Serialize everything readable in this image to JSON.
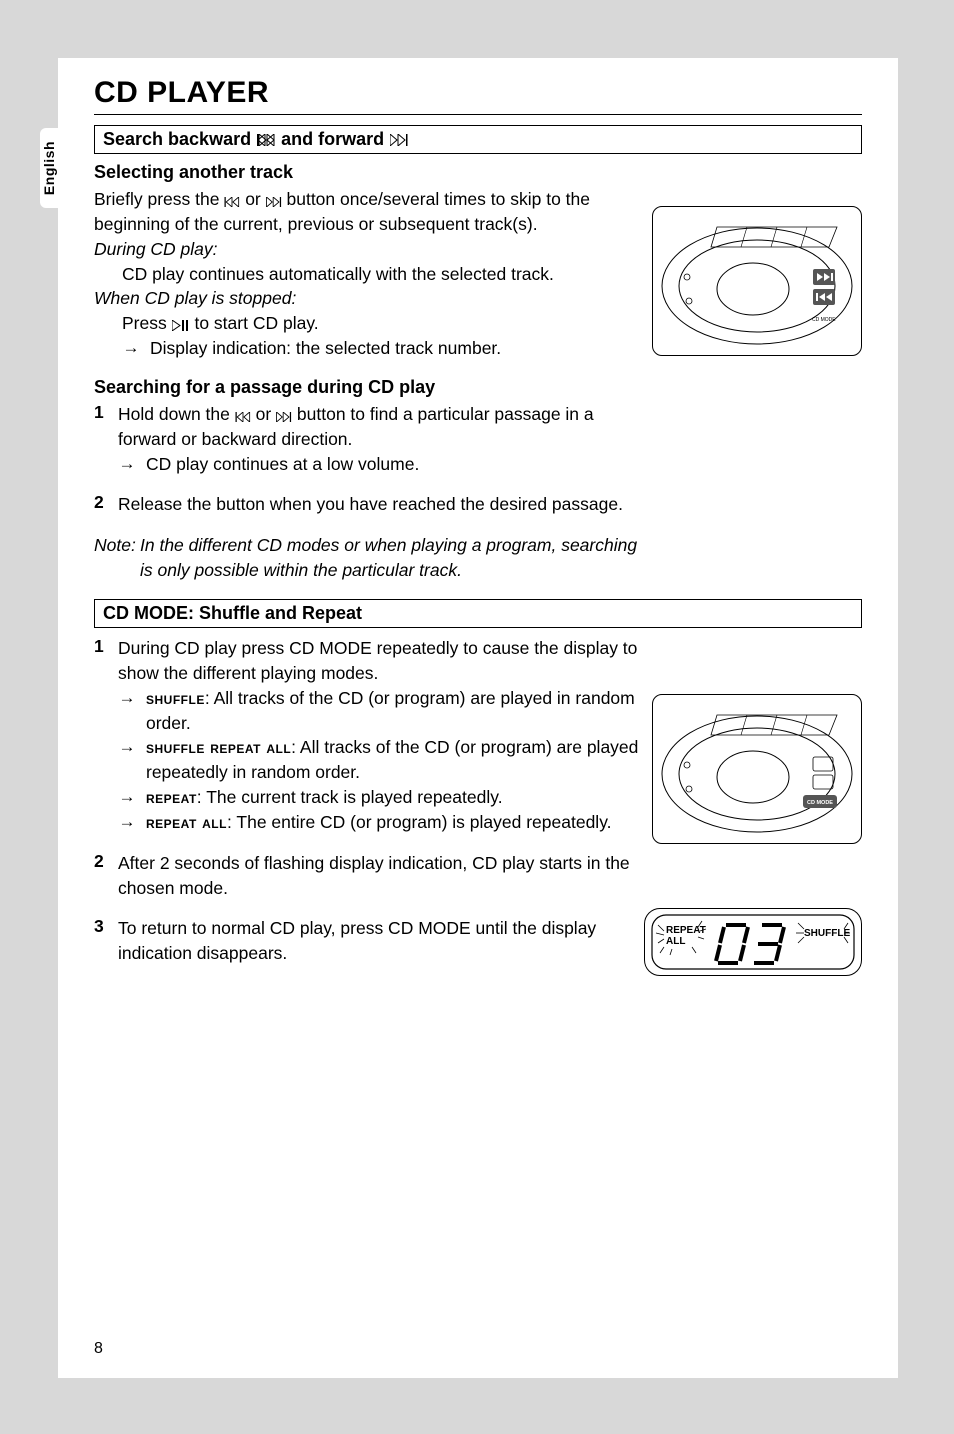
{
  "side_tab": "English",
  "page_title": "CD PLAYER",
  "section1": {
    "heading_pre": "Search backward ",
    "heading_mid": " and forward "
  },
  "sel_track": {
    "heading": "Selecting another track",
    "p1a": "Briefly press the ",
    "p1b": " or ",
    "p1c": " button once/several times to skip to the beginning of the current, previous or subsequent track(s).",
    "during": "During CD play:",
    "during_line": "CD play continues automatically with the selected track.",
    "stopped": "When CD play is stopped:",
    "stopped_line_a": "Press ",
    "stopped_line_b": " to start CD play.",
    "arrow1": "Display indication: the selected track number."
  },
  "search_passage": {
    "heading": "Searching for a passage during CD play",
    "s1a": "Hold down the ",
    "s1b": " or ",
    "s1c": " button to find a particular passage in a forward or backward direction.",
    "s1_arrow": "CD play continues at a low volume.",
    "s2": "Release the button when you have reached the desired passage.",
    "note": "Note: In the different CD modes or when playing a program, searching is only possible within the particular track."
  },
  "section2": {
    "heading": "CD MODE: Shuffle and Repeat",
    "s1_intro": "During CD play press CD MODE repeatedly to cause the display to show the different playing modes.",
    "b1_label": "shuffle",
    "b1_text": ": All tracks of the CD (or program) are played in random order.",
    "b2_label": "shuffle repeat all",
    "b2_text": ": All tracks of the CD (or program) are played repeatedly in random order.",
    "b3_label": "repeat",
    "b3_text": ": The current track is played repeatedly.",
    "b4_label": "repeat all",
    "b4_text": ": The entire CD (or program) is played repeatedly.",
    "s2": "After 2 seconds of flashing display indication, CD play starts in the chosen mode.",
    "s3": "To return to normal CD play, press CD MODE until the display indication disappears."
  },
  "lcd": {
    "repeat": "REPEAT",
    "all": "ALL",
    "shuffle": "SHUFFLE",
    "track": "03"
  },
  "page_number": "8",
  "nums": {
    "n1": "1",
    "n2": "2",
    "n3": "3"
  }
}
